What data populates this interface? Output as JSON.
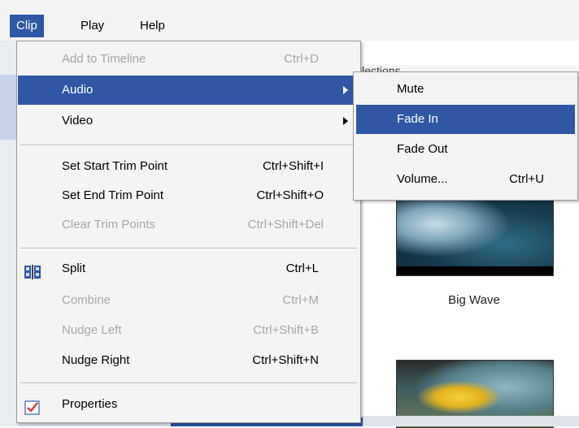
{
  "menubar": {
    "items": [
      {
        "label": "Clip",
        "active": true
      },
      {
        "label": "Play"
      },
      {
        "label": "Help"
      }
    ]
  },
  "background": {
    "collections_label": "llections",
    "thumbnail_1_caption": "Big Wave"
  },
  "clip_menu": {
    "items": [
      {
        "label": "Add to Timeline",
        "shortcut": "Ctrl+D",
        "disabled": true
      },
      {
        "label": "Audio",
        "submenu": true,
        "highlighted": true
      },
      {
        "label": "Video",
        "submenu": true
      },
      {
        "label": "Set Start Trim Point",
        "shortcut": "Ctrl+Shift+I"
      },
      {
        "label": "Set End Trim Point",
        "shortcut": "Ctrl+Shift+O"
      },
      {
        "label": "Clear Trim Points",
        "shortcut": "Ctrl+Shift+Del",
        "disabled": true
      },
      {
        "label": "Split",
        "shortcut": "Ctrl+L",
        "icon": "split-icon"
      },
      {
        "label": "Combine",
        "shortcut": "Ctrl+M",
        "disabled": true
      },
      {
        "label": "Nudge Left",
        "shortcut": "Ctrl+Shift+B",
        "disabled": true
      },
      {
        "label": "Nudge Right",
        "shortcut": "Ctrl+Shift+N"
      },
      {
        "label": "Properties",
        "icon": "properties-checkmark-icon"
      }
    ]
  },
  "audio_submenu": {
    "items": [
      {
        "label": "Mute"
      },
      {
        "label": "Fade In",
        "highlighted": true
      },
      {
        "label": "Fade Out"
      },
      {
        "label": "Volume...",
        "shortcut": "Ctrl+U"
      }
    ]
  },
  "colors": {
    "highlight": "#2f57a4",
    "menu_background": "#f4f4f4",
    "disabled_text": "#a8a8a8"
  }
}
